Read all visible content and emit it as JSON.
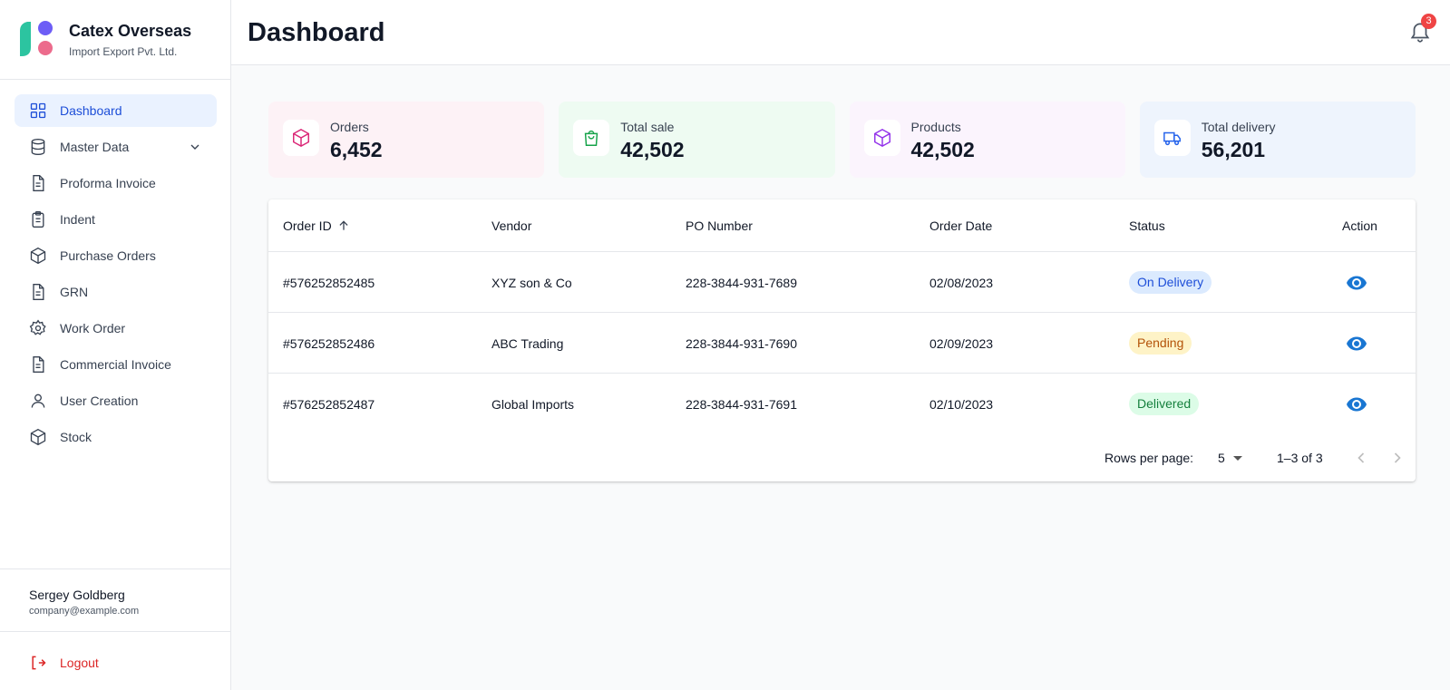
{
  "brand": {
    "name": "Catex Overseas",
    "subtitle": "Import Export Pvt. Ltd."
  },
  "sidebar": {
    "items": [
      {
        "label": "Dashboard",
        "icon": "grid-icon",
        "active": true
      },
      {
        "label": "Master Data",
        "icon": "database-icon",
        "expandable": true
      },
      {
        "label": "Proforma Invoice",
        "icon": "document-icon"
      },
      {
        "label": "Indent",
        "icon": "clipboard-icon"
      },
      {
        "label": "Purchase Orders",
        "icon": "box-icon"
      },
      {
        "label": "GRN",
        "icon": "document-icon"
      },
      {
        "label": "Work Order",
        "icon": "gear-icon"
      },
      {
        "label": "Commercial Invoice",
        "icon": "document-icon"
      },
      {
        "label": "User Creation",
        "icon": "user-icon"
      },
      {
        "label": "Stock",
        "icon": "box-icon"
      }
    ],
    "user": {
      "name": "Sergey Goldberg",
      "email": "company@example.com"
    },
    "logout_label": "Logout"
  },
  "header": {
    "title": "Dashboard",
    "notification_count": "3"
  },
  "stats": [
    {
      "label": "Orders",
      "value": "6,452",
      "icon": "box-icon",
      "bg": "#fdf2f6",
      "color": "#db2777"
    },
    {
      "label": "Total sale",
      "value": "42,502",
      "icon": "shopping-bag-icon",
      "bg": "#eefbf2",
      "color": "#16a34a"
    },
    {
      "label": "Products",
      "value": "42,502",
      "icon": "box-icon",
      "bg": "#fbf4fd",
      "color": "#9333ea"
    },
    {
      "label": "Total delivery",
      "value": "56,201",
      "icon": "truck-icon",
      "bg": "#eef4fd",
      "color": "#2563eb"
    }
  ],
  "table": {
    "columns": [
      "Order ID",
      "Vendor",
      "PO Number",
      "Order Date",
      "Status",
      "Action"
    ],
    "rows": [
      {
        "order_id": "#576252852485",
        "vendor": "XYZ son & Co",
        "po_number": "228-3844-931-7689",
        "order_date": "02/08/2023",
        "status": "On Delivery"
      },
      {
        "order_id": "#576252852486",
        "vendor": "ABC Trading",
        "po_number": "228-3844-931-7690",
        "order_date": "02/09/2023",
        "status": "Pending"
      },
      {
        "order_id": "#576252852487",
        "vendor": "Global Imports",
        "po_number": "228-3844-931-7691",
        "order_date": "02/10/2023",
        "status": "Delivered"
      }
    ],
    "status_styles": {
      "On Delivery": {
        "bg": "#dbeafe",
        "color": "#1d4ed8"
      },
      "Pending": {
        "bg": "#fef3c7",
        "color": "#b45309"
      },
      "Delivered": {
        "bg": "#dcfce7",
        "color": "#15803d"
      }
    },
    "pagination": {
      "rows_per_page_label": "Rows per page:",
      "rows_per_page": "5",
      "range": "1–3 of 3"
    }
  },
  "colors": {
    "accent": "#1d4ed8",
    "eye": "#1976d2",
    "logout": "#dc2626"
  }
}
